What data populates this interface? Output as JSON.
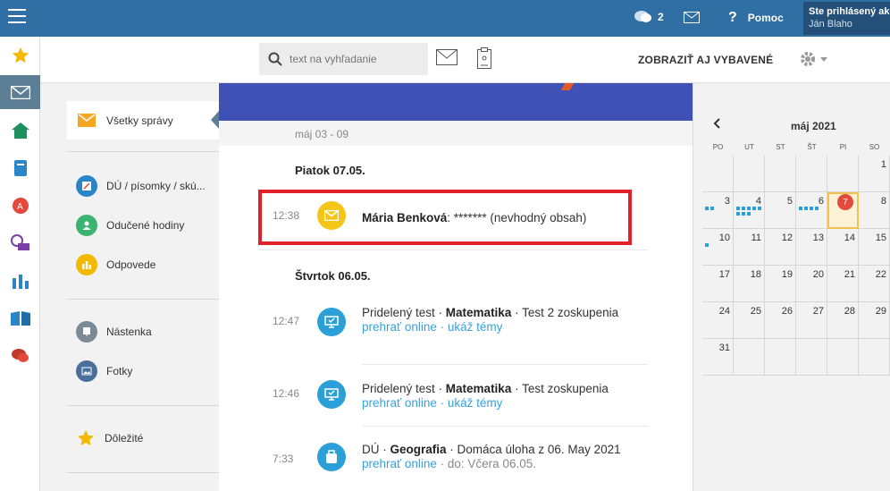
{
  "topbar": {
    "chat_count": "2",
    "help_label": "Pomoc",
    "user_line1": "Ste prihlásený ako",
    "user_line2": "Ján Blaho"
  },
  "toolbar": {
    "search_placeholder": "text na vyhľadanie",
    "show_selected_label": "ZOBRAZIŤ AJ VYBAVENÉ"
  },
  "folders": {
    "all_messages": "Všetky správy",
    "homework": "DÚ / písomky / skú...",
    "taught_hours": "Odučené hodiny",
    "answers": "Odpovede",
    "board": "Nástenka",
    "photos": "Fotky",
    "important": "Dôležité"
  },
  "messages": {
    "week_range": "máj 03 - 09",
    "day1": "Piatok 07.05.",
    "day2": "Štvrtok 06.05.",
    "m1": {
      "time": "12:38",
      "sender": "Mária Benková",
      "text": ": ******* (nevhodný obsah)"
    },
    "m2": {
      "time": "12:47",
      "prefix": "Pridelený test",
      "subject": "Matematika",
      "text": "Test 2 zoskupenia",
      "link1": "prehrať online",
      "link2": "ukáž témy"
    },
    "m3": {
      "time": "12:46",
      "prefix": "Pridelený test",
      "subject": "Matematika",
      "text": "Test zoskupenia",
      "link1": "prehrať online",
      "link2": "ukáž témy"
    },
    "m4": {
      "time": "7:33",
      "prefix": "DÚ",
      "subject": "Geografia",
      "text": "Domáca úloha z 06. May 2021",
      "link1": "prehrať online",
      "due": "do: Včera 06.05."
    }
  },
  "calendar": {
    "month": "máj 2021",
    "days_of_week": [
      "PO",
      "UT",
      "ST",
      "ŠT",
      "PI",
      "SO"
    ],
    "today_badge": "7",
    "weeks": [
      [
        "",
        "",
        "",
        "",
        "",
        "1"
      ],
      [
        "3",
        "4",
        "5",
        "6",
        "7",
        "8"
      ],
      [
        "10",
        "11",
        "12",
        "13",
        "14",
        "15"
      ],
      [
        "17",
        "18",
        "19",
        "20",
        "21",
        "22"
      ],
      [
        "24",
        "25",
        "26",
        "27",
        "28",
        "29"
      ],
      [
        "31",
        "",
        "",
        "",
        "",
        ""
      ]
    ]
  },
  "colors": {
    "topbar": "#2f6fa4",
    "banner": "#3f51b5",
    "link": "#3aa0dc",
    "highlight": "#e0202a"
  }
}
